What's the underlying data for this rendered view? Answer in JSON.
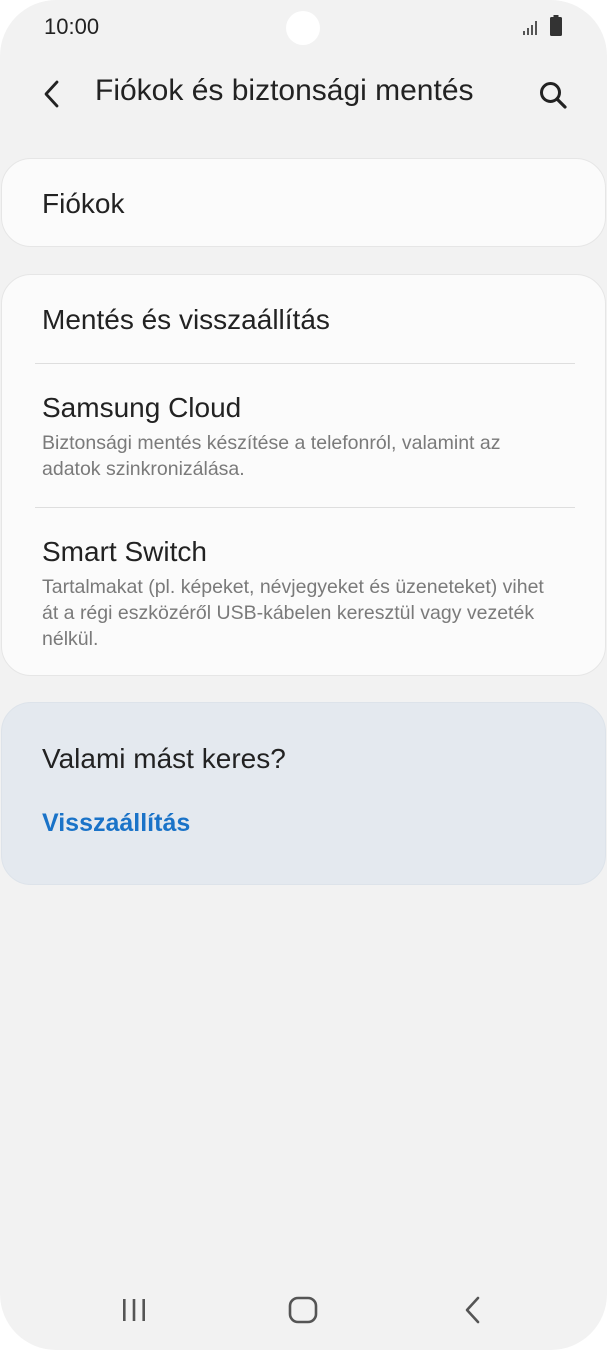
{
  "status_bar": {
    "time": "10:00",
    "icons": [
      "signal-icon",
      "battery-icon"
    ]
  },
  "header": {
    "title": "Fiókok és biztonsági mentés",
    "back_icon": "chevron-left-icon",
    "search_icon": "search-icon"
  },
  "accounts": {
    "label": "Fiókok"
  },
  "backup_section": {
    "items": [
      {
        "title": "Mentés és visszaállítás",
        "subtitle": ""
      },
      {
        "title": "Samsung Cloud",
        "subtitle": "Biztonsági mentés készítése a telefonról, valamint az adatok szinkronizálása."
      },
      {
        "title": "Smart Switch",
        "subtitle": "Tartalmakat (pl. képeket, névjegyeket és üzeneteket) vihet át a régi eszközéről USB-kábelen keresztül vagy vezeték nélkül."
      }
    ]
  },
  "suggestion": {
    "title": "Valami mást keres?",
    "link": "Visszaállítás",
    "link_color": "#1a73c8"
  },
  "nav_bar": {
    "buttons": [
      "recent-apps-icon",
      "home-icon",
      "back-icon"
    ]
  }
}
